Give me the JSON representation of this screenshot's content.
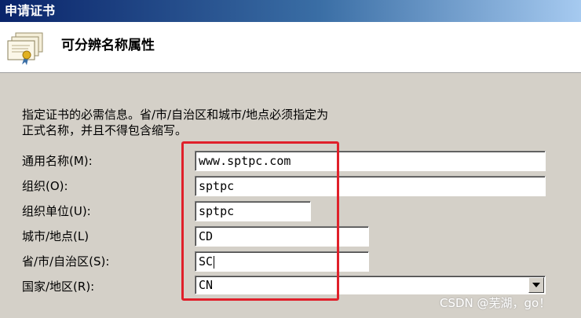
{
  "window": {
    "title": "申请证书"
  },
  "header": {
    "title": "可分辨名称属性",
    "icon": "certificate-icon"
  },
  "description": "指定证书的必需信息。省/市/自治区和城市/地点必须指定为\n正式名称，并且不得包含缩写。",
  "form": {
    "common_name": {
      "label": "通用名称(M):",
      "value": "www.sptpc.com"
    },
    "organization": {
      "label": "组织(O):",
      "value": "sptpc"
    },
    "org_unit": {
      "label": "组织单位(U):",
      "value": "sptpc"
    },
    "city": {
      "label": "城市/地点(L)",
      "value": "CD"
    },
    "state": {
      "label": "省/市/自治区(S):",
      "value": "SC"
    },
    "country": {
      "label": "国家/地区(R):",
      "value": "CN"
    }
  },
  "watermark": "CSDN @芜湖，go！",
  "colors": {
    "title_bar": "#0a246a",
    "highlight": "#e0202a",
    "dialog_bg": "#d4d0c8"
  }
}
